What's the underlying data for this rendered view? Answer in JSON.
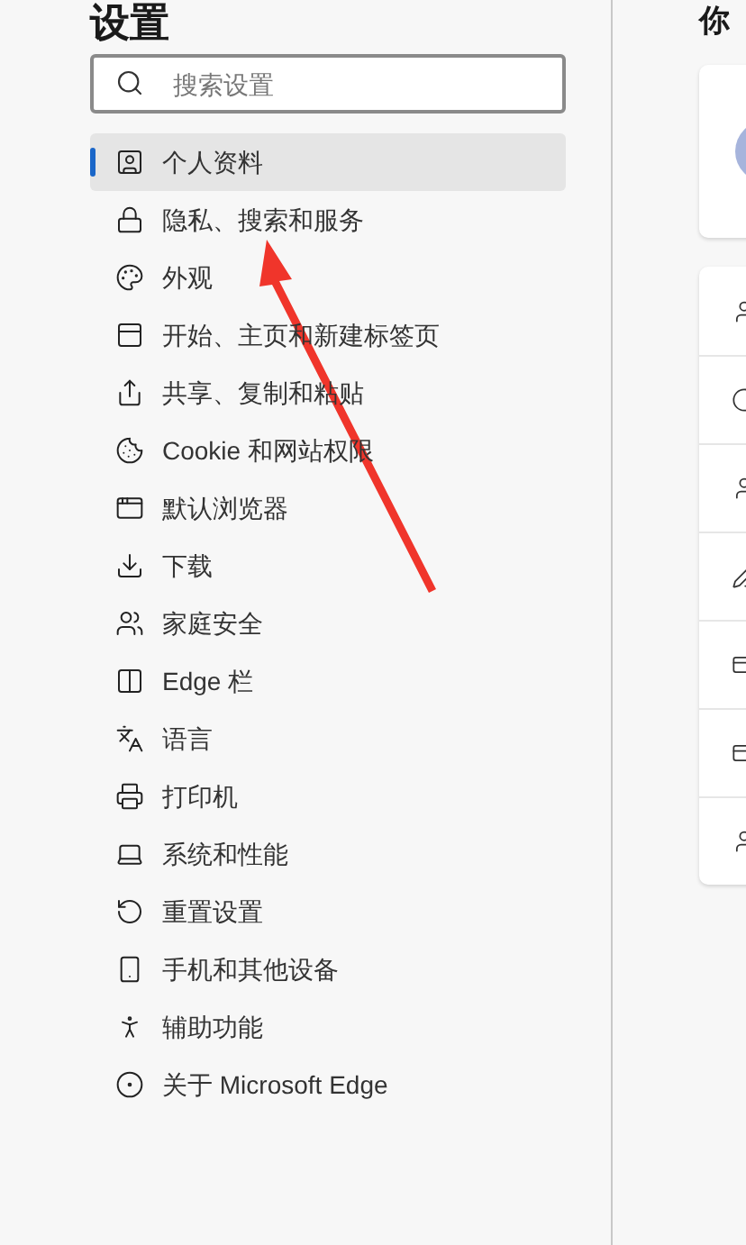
{
  "sidebar": {
    "title": "设置",
    "search": {
      "placeholder": "搜索设置"
    },
    "items": [
      {
        "label": "个人资料",
        "kind": "profile",
        "selected": true
      },
      {
        "label": "隐私、搜索和服务",
        "kind": "lock",
        "selected": false
      },
      {
        "label": "外观",
        "kind": "palette",
        "selected": false
      },
      {
        "label": "开始、主页和新建标签页",
        "kind": "startpage",
        "selected": false
      },
      {
        "label": "共享、复制和粘贴",
        "kind": "share",
        "selected": false
      },
      {
        "label": "Cookie 和网站权限",
        "kind": "cookie",
        "selected": false
      },
      {
        "label": "默认浏览器",
        "kind": "browser",
        "selected": false
      },
      {
        "label": "下载",
        "kind": "download",
        "selected": false
      },
      {
        "label": "家庭安全",
        "kind": "family",
        "selected": false
      },
      {
        "label": "Edge 栏",
        "kind": "bar",
        "selected": false
      },
      {
        "label": "语言",
        "kind": "language",
        "selected": false
      },
      {
        "label": "打印机",
        "kind": "printer",
        "selected": false
      },
      {
        "label": "系统和性能",
        "kind": "laptop",
        "selected": false
      },
      {
        "label": "重置设置",
        "kind": "reset",
        "selected": false
      },
      {
        "label": "手机和其他设备",
        "kind": "phone",
        "selected": false
      },
      {
        "label": "辅助功能",
        "kind": "accessibility",
        "selected": false
      },
      {
        "label": "关于 Microsoft Edge",
        "kind": "edge",
        "selected": false
      }
    ]
  },
  "main": {
    "title": "你",
    "rows": [
      {
        "kind": "person"
      },
      {
        "kind": "circle"
      },
      {
        "kind": "person"
      },
      {
        "kind": "pen"
      },
      {
        "kind": "card"
      },
      {
        "kind": "card"
      },
      {
        "kind": "person"
      }
    ]
  }
}
